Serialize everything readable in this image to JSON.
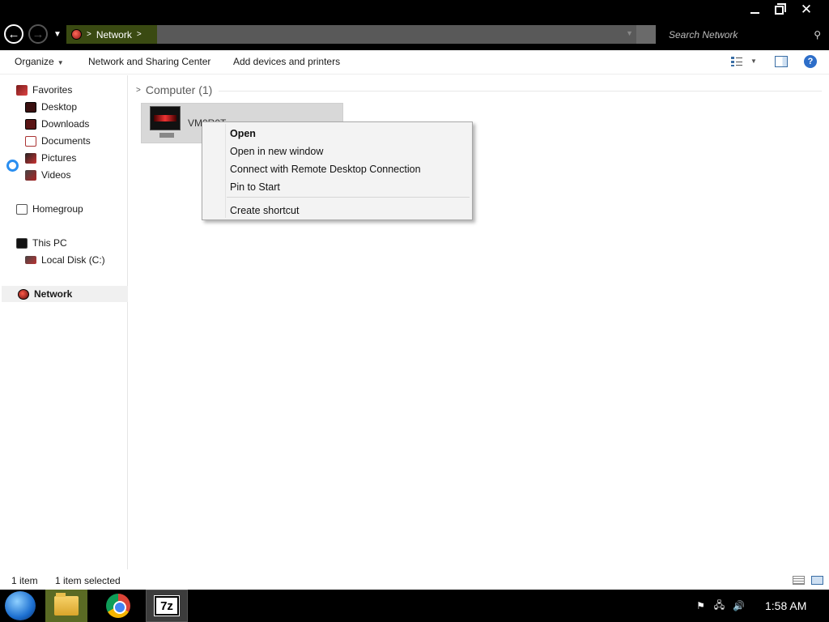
{
  "window": {
    "controls": {
      "minimize": "minimize",
      "maximize": "restore",
      "close": "✕"
    }
  },
  "address": {
    "crumbs": [
      "Network"
    ],
    "search_placeholder": "Search Network"
  },
  "toolbar": {
    "organize_label": "Organize",
    "network_sharing_label": "Network and Sharing Center",
    "add_devices_label": "Add devices and printers"
  },
  "sidebar": {
    "items": [
      {
        "label": "Favorites",
        "icon": "favorites-icon"
      },
      {
        "label": "Desktop",
        "icon": "desktop-icon"
      },
      {
        "label": "Downloads",
        "icon": "downloads-icon"
      },
      {
        "label": "Documents",
        "icon": "documents-icon"
      },
      {
        "label": "Pictures",
        "icon": "pictures-icon"
      },
      {
        "label": "Videos",
        "icon": "videos-icon"
      },
      {
        "label": "Homegroup",
        "icon": "homegroup-icon"
      },
      {
        "label": "This PC",
        "icon": "this-pc-icon"
      },
      {
        "label": "Local Disk (C:)",
        "icon": "local-disk-icon"
      },
      {
        "label": "Network",
        "icon": "network-icon",
        "selected": true
      }
    ]
  },
  "content": {
    "group_header": "Computer (1)",
    "item_name": "VM0R0T"
  },
  "context_menu": {
    "items": [
      {
        "label": "Open",
        "bold": true
      },
      {
        "label": "Open in new window"
      },
      {
        "label": "Connect with Remote Desktop Connection"
      },
      {
        "label": "Pin to Start"
      },
      {
        "label": "Create shortcut"
      }
    ]
  },
  "status": {
    "item_count": "1 item",
    "selection": "1 item selected"
  },
  "taskbar": {
    "apps": [
      "file-explorer",
      "chrome",
      "7-zip"
    ],
    "sevenzip_label": "7z",
    "clock": "1:58 AM"
  },
  "colors": {
    "titlebar": "#000000",
    "crumb_bg": "#3a4a12",
    "context_menu_bg": "#f3f3f3",
    "selection_bg": "#d8d8d8"
  }
}
